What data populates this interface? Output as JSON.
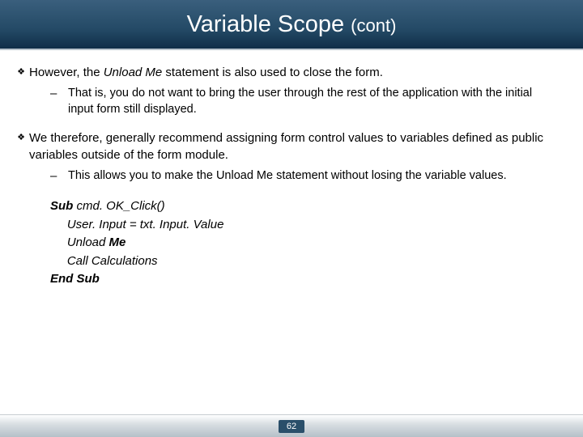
{
  "title": {
    "main": "Variable Scope ",
    "cont": "(cont)"
  },
  "bullets": [
    {
      "marker": "❖",
      "pre": "However, the ",
      "em": "Unload Me",
      "post": " statement is also used to close the form.",
      "sub": {
        "marker": "–",
        "text": "That is, you do not want to bring the user through the rest of the application with the initial input form still displayed."
      }
    },
    {
      "marker": "❖",
      "text": "We therefore, generally recommend assigning form control values to variables defined as public variables outside of the form module.",
      "sub": {
        "marker": "–",
        "text": "This allows you to make the Unload Me statement without losing the variable values."
      }
    }
  ],
  "code": {
    "l1a": "Sub ",
    "l1b": "cmd. OK_Click()",
    "l2": "     User. Input = txt. Input. Value",
    "l3": "",
    "l4a": "     Unload ",
    "l4b": "Me",
    "l5": "     Call Calculations",
    "l6": "End Sub"
  },
  "page": "62"
}
